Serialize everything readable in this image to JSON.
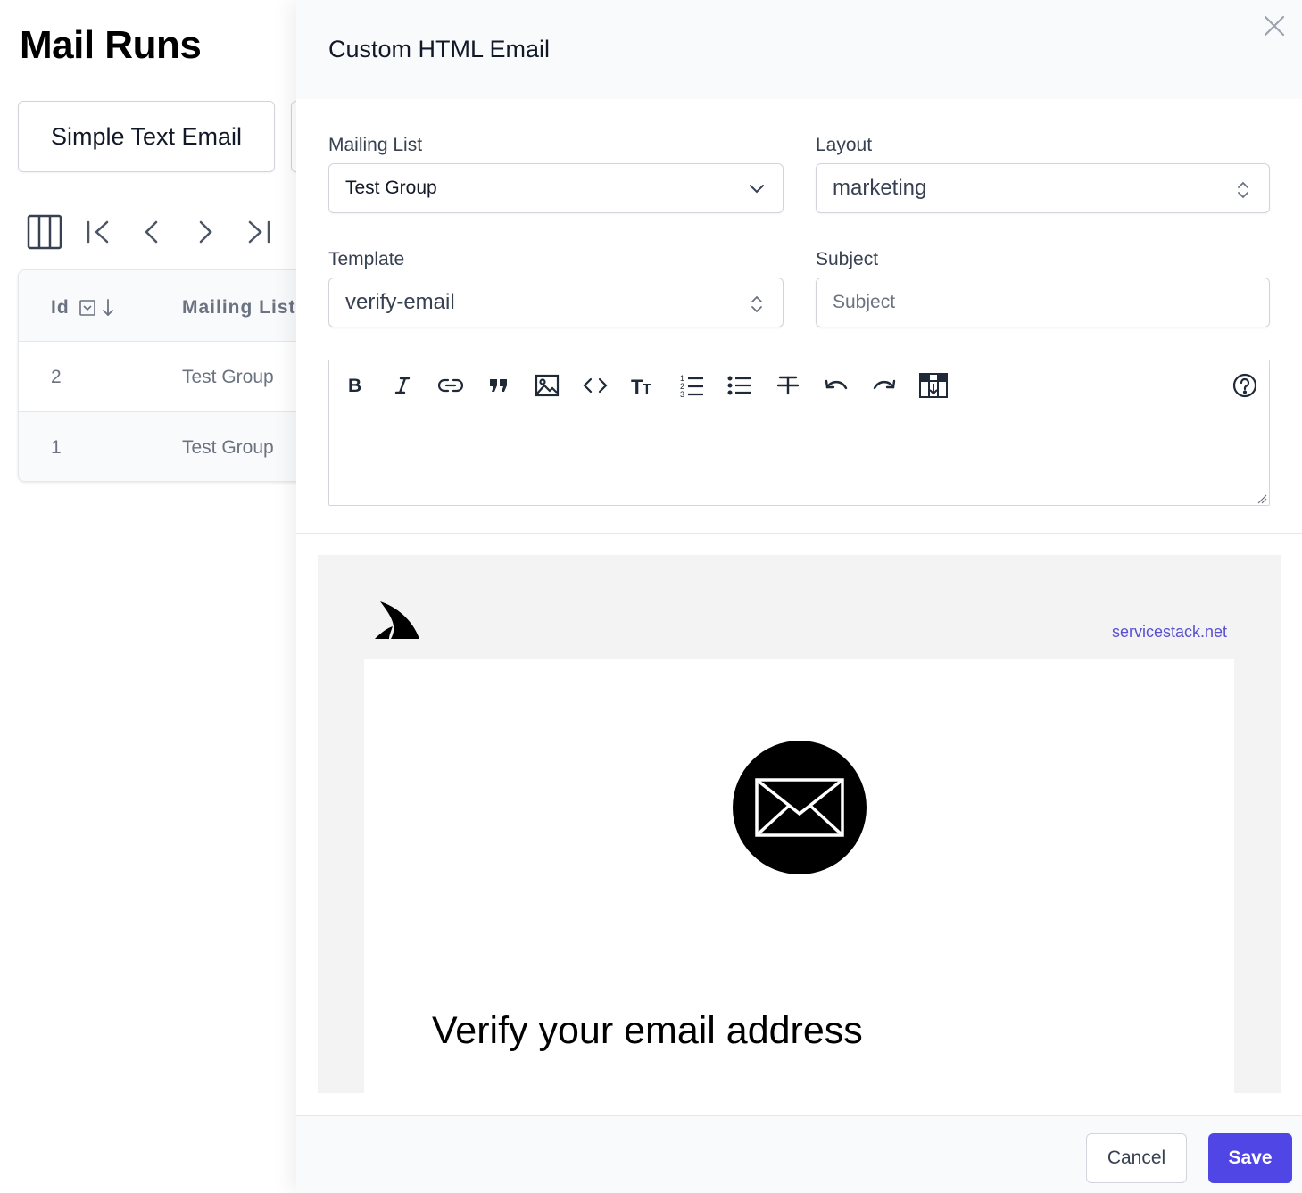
{
  "page": {
    "title": "Mail Runs",
    "tabs": [
      {
        "label": "Simple Text Email"
      }
    ],
    "table": {
      "columns": [
        "Id",
        "Mailing List"
      ],
      "rows": [
        {
          "id": "2",
          "mailing_list": "Test Group"
        },
        {
          "id": "1",
          "mailing_list": "Test Group"
        }
      ]
    }
  },
  "panel": {
    "title": "Custom HTML Email",
    "fields": {
      "mailing_list": {
        "label": "Mailing List",
        "value": "Test Group"
      },
      "layout": {
        "label": "Layout",
        "value": "marketing"
      },
      "template": {
        "label": "Template",
        "value": "verify-email"
      },
      "subject": {
        "label": "Subject",
        "placeholder": "Subject",
        "value": ""
      }
    },
    "editor_toolbar": [
      "bold-icon",
      "italic-icon",
      "link-icon",
      "quote-icon",
      "image-icon",
      "code-icon",
      "heading-icon",
      "ordered-list-icon",
      "unordered-list-icon",
      "strikethrough-icon",
      "undo-icon",
      "redo-icon",
      "insert-template-icon",
      "help-icon"
    ],
    "preview": {
      "site_link": "servicestack.net",
      "heading": "Verify your email address"
    },
    "footer": {
      "cancel_label": "Cancel",
      "save_label": "Save"
    }
  },
  "colors": {
    "primary": "#4f46e5",
    "link": "#5b4fd1"
  }
}
